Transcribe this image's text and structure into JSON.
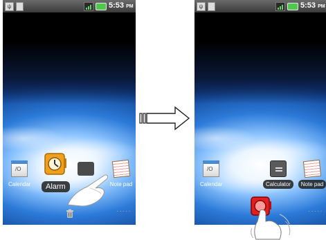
{
  "left_screen": {
    "status_time": "5:53",
    "status_ampm": "PM",
    "shortcuts": [
      {
        "label": "Calendar",
        "icon": "calendar-icon"
      },
      {
        "label": "Alarm",
        "icon": "alarm-clock-icon"
      },
      {
        "label": "Note pad",
        "icon": "notepad-icon"
      }
    ],
    "trash_icon": "trash-icon"
  },
  "right_screen": {
    "status_time": "5:53",
    "status_ampm": "PM",
    "shortcuts": [
      {
        "label": "Calendar",
        "icon": "calendar-icon"
      },
      {
        "label": "Calculator",
        "icon": "calculator-icon"
      },
      {
        "label": "Note pad",
        "icon": "notepad-icon"
      }
    ],
    "dragged_icon": "alarm-clock-icon"
  },
  "arrow": "right-arrow",
  "colors": {
    "status_bar": "#4a4a4a",
    "battery": "#4ec94e",
    "alarm_orange": "#f0a020",
    "alarm_red": "#e02020"
  }
}
